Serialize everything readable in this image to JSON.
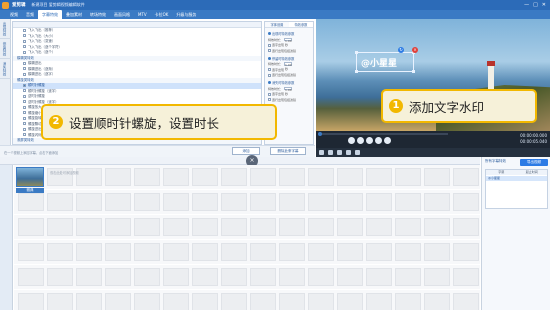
{
  "app": {
    "name": "爱剪辑",
    "project": "新建项目  爱剪辑视频编辑软件",
    "window_buttons": [
      "—",
      "□",
      "✕"
    ]
  },
  "menu": {
    "tabs": [
      "视频",
      "音频",
      "字幕特效",
      "叠加素材",
      "转场特效",
      "画面风格",
      "MTV",
      "卡拉OK",
      "升级与服务"
    ],
    "active_index": 2
  },
  "left_tabs": [
    "出现特效",
    "停留特效",
    "消失特效"
  ],
  "effects_list": {
    "items": [
      {
        "label": "飞入飞出（推荐）",
        "type": "item"
      },
      {
        "label": "飞入飞出（大小）",
        "type": "item"
      },
      {
        "label": "飞入飞出（变速）",
        "type": "item"
      },
      {
        "label": "飞入飞出（逐个字符）",
        "type": "item"
      },
      {
        "label": "飞入飞出（逐个）",
        "type": "item"
      },
      {
        "label": "模糊类特效",
        "type": "group"
      },
      {
        "label": "模糊进出",
        "type": "item"
      },
      {
        "label": "模糊进出（逐渐）",
        "type": "item"
      },
      {
        "label": "模糊进出（逐字）",
        "type": "item"
      },
      {
        "label": "螺旋类特效",
        "type": "group"
      },
      {
        "label": "顺时针螺旋",
        "type": "item",
        "selected": true
      },
      {
        "label": "顺时针螺旋（逐字）",
        "type": "item"
      },
      {
        "label": "逆时针螺旋",
        "type": "item"
      },
      {
        "label": "逆时针螺旋（逐字）",
        "type": "item"
      },
      {
        "label": "螺旋放大",
        "type": "item"
      },
      {
        "label": "螺旋缩小",
        "type": "item"
      },
      {
        "label": "螺旋旋转",
        "type": "item"
      },
      {
        "label": "螺旋飘动",
        "type": "item"
      },
      {
        "label": "螺旋进出",
        "type": "item"
      },
      {
        "label": "螺旋闪烁",
        "type": "item"
      },
      {
        "label": "滚屏类特效",
        "type": "group"
      },
      {
        "label": "向上滚动字幕",
        "type": "item"
      },
      {
        "label": "向下滚动字幕",
        "type": "item"
      },
      {
        "label": "向左滚动字幕",
        "type": "item"
      },
      {
        "label": "向右滚动字幕",
        "type": "item"
      }
    ]
  },
  "config": {
    "tabs": [
      "字体设置",
      "特效参数"
    ],
    "sections": [
      {
        "title": "出现时特效参数",
        "duration_label": "特效时长：",
        "duration": "1.00 秒",
        "options": [
          "逐字出现",
          "逐行出现包括滤镜"
        ]
      },
      {
        "title": "停留时特效参数",
        "duration_label": "特效时长：",
        "duration": "1.00 秒",
        "options": [
          "逐字出现",
          "逐行出现包括滤镜"
        ]
      },
      {
        "title": "消失时特效参数",
        "duration_label": "特效时长：",
        "duration": "1.00 秒",
        "options": [
          "逐字出现",
          "逐行出现包括滤镜"
        ]
      }
    ]
  },
  "below": {
    "hint": "在一个视频上添加字幕，点击下面添加",
    "add_button": "添加",
    "remove_button": "删除此条字幕"
  },
  "preview": {
    "watermark_text": "@小星星"
  },
  "player": {
    "time_current": "00:00:00.000",
    "time_total": "00:00:05.040"
  },
  "timeline": {
    "clip_label": "雅典",
    "caption": "双击此处可添加视频"
  },
  "right_panel": {
    "title": "所有字幕特效",
    "export_button": "导出视频",
    "columns": [
      "字幕",
      "起止时间"
    ],
    "rows": [
      "@小星星"
    ]
  },
  "callouts": [
    {
      "num": "1",
      "text": "添加文字水印"
    },
    {
      "num": "2",
      "text": "设置顺时针螺旋，设置时长"
    }
  ]
}
